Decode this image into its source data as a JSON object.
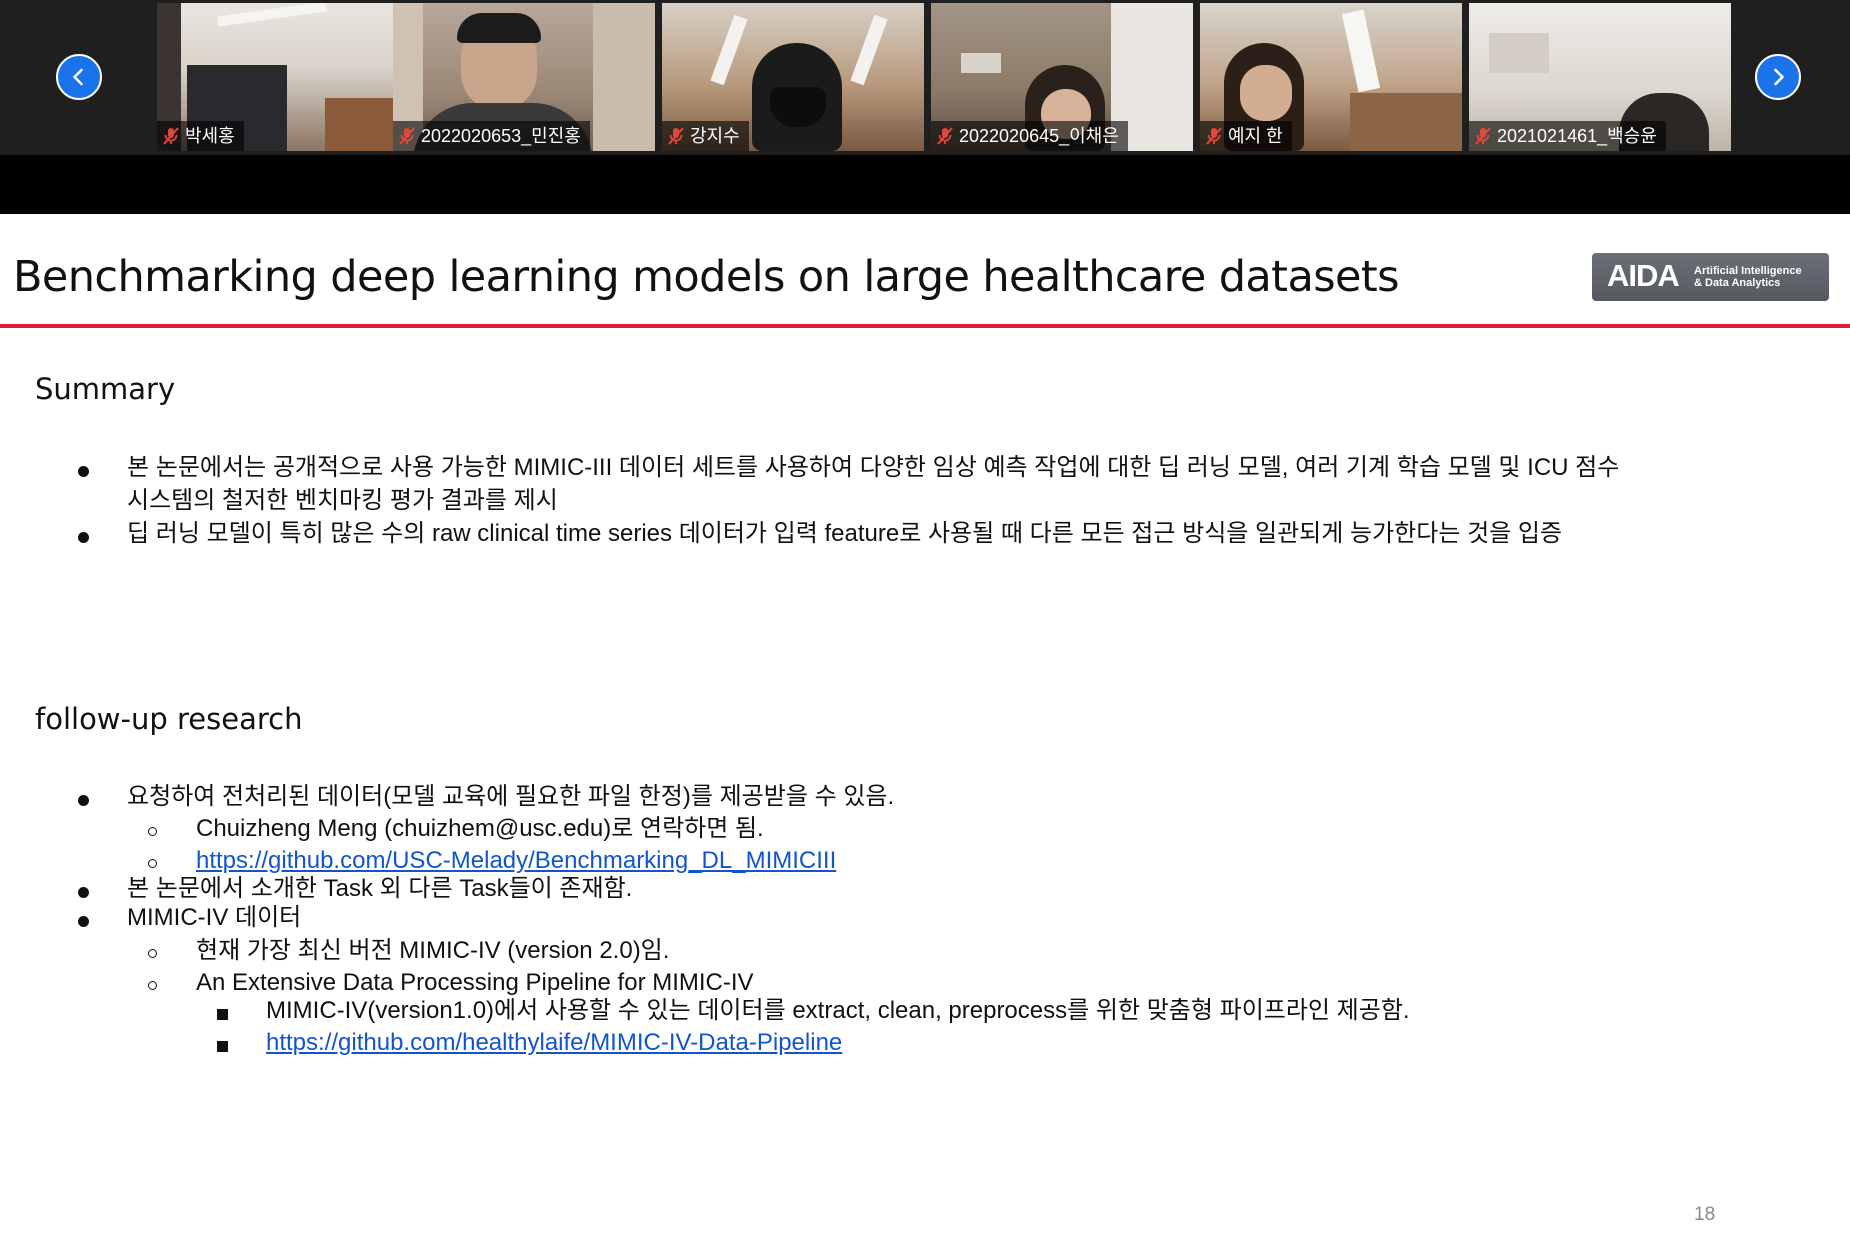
{
  "participants": [
    {
      "name": "박세홍",
      "mic": "muted"
    },
    {
      "name": "2022020653_민진홍",
      "mic": "muted"
    },
    {
      "name": "강지수",
      "mic": "muted"
    },
    {
      "name": "2022020645_이채은",
      "mic": "muted"
    },
    {
      "name": "예지 한",
      "mic": "muted"
    },
    {
      "name": "2021021461_백승윤",
      "mic": "muted"
    }
  ],
  "slide": {
    "title": "Benchmarking deep learning models on large healthcare datasets",
    "logo": {
      "main": "AIDA",
      "sub_line1": "Artificial Intelligence",
      "sub_line2": "& Data Analytics"
    },
    "summary": {
      "heading": "Summary",
      "bullets": [
        {
          "line1": "본 논문에서는 공개적으로 사용 가능한 MIMIC-III 데이터 세트를 사용하여 다양한 임상 예측 작업에 대한 딥 러닝 모델, 여러 기계 학습 모델 및 ICU 점수",
          "line2": "시스템의 철저한 벤치마킹 평가 결과를 제시"
        },
        {
          "line1": "딥 러닝 모델이 특히 많은 수의 raw clinical time series 데이터가 입력 feature로 사용될 때  다른 모든 접근 방식을 일관되게 능가한다는 것을 입증"
        }
      ]
    },
    "followup": {
      "heading": "follow-up research",
      "bullet1": "요청하여 전처리된 데이터(모델 교육에 필요한 파일 한정)를 제공받을 수 있음.",
      "bullet1_sub1": "Chuizheng Meng (chuizhem@usc.edu)로 연락하면 됨.",
      "bullet1_sub2_link": "https://github.com/USC-Melady/Benchmarking_DL_MIMICIII",
      "bullet2": "본 논문에서 소개한 Task 외 다른 Task들이 존재함.",
      "bullet3": "MIMIC-IV 데이터",
      "bullet3_sub1": "현재 가장 최신 버전 MIMIC-IV (version 2.0)임.",
      "bullet3_sub2": "An Extensive Data Processing Pipeline for MIMIC-IV",
      "bullet3_sub2_item1": "MIMIC-IV(version1.0)에서 사용할 수 있는 데이터를 extract, clean, preprocess를 위한 맞춤형 파이프라인 제공함.",
      "bullet3_sub2_item2_link": "https://github.com/healthylaife/MIMIC-IV-Data-Pipeline"
    },
    "page_number": "18"
  },
  "colors": {
    "accent_rule": "#e21b38",
    "nav_button": "#1a73e8",
    "link": "#1155cc",
    "muted_mic": "#e8453c"
  }
}
